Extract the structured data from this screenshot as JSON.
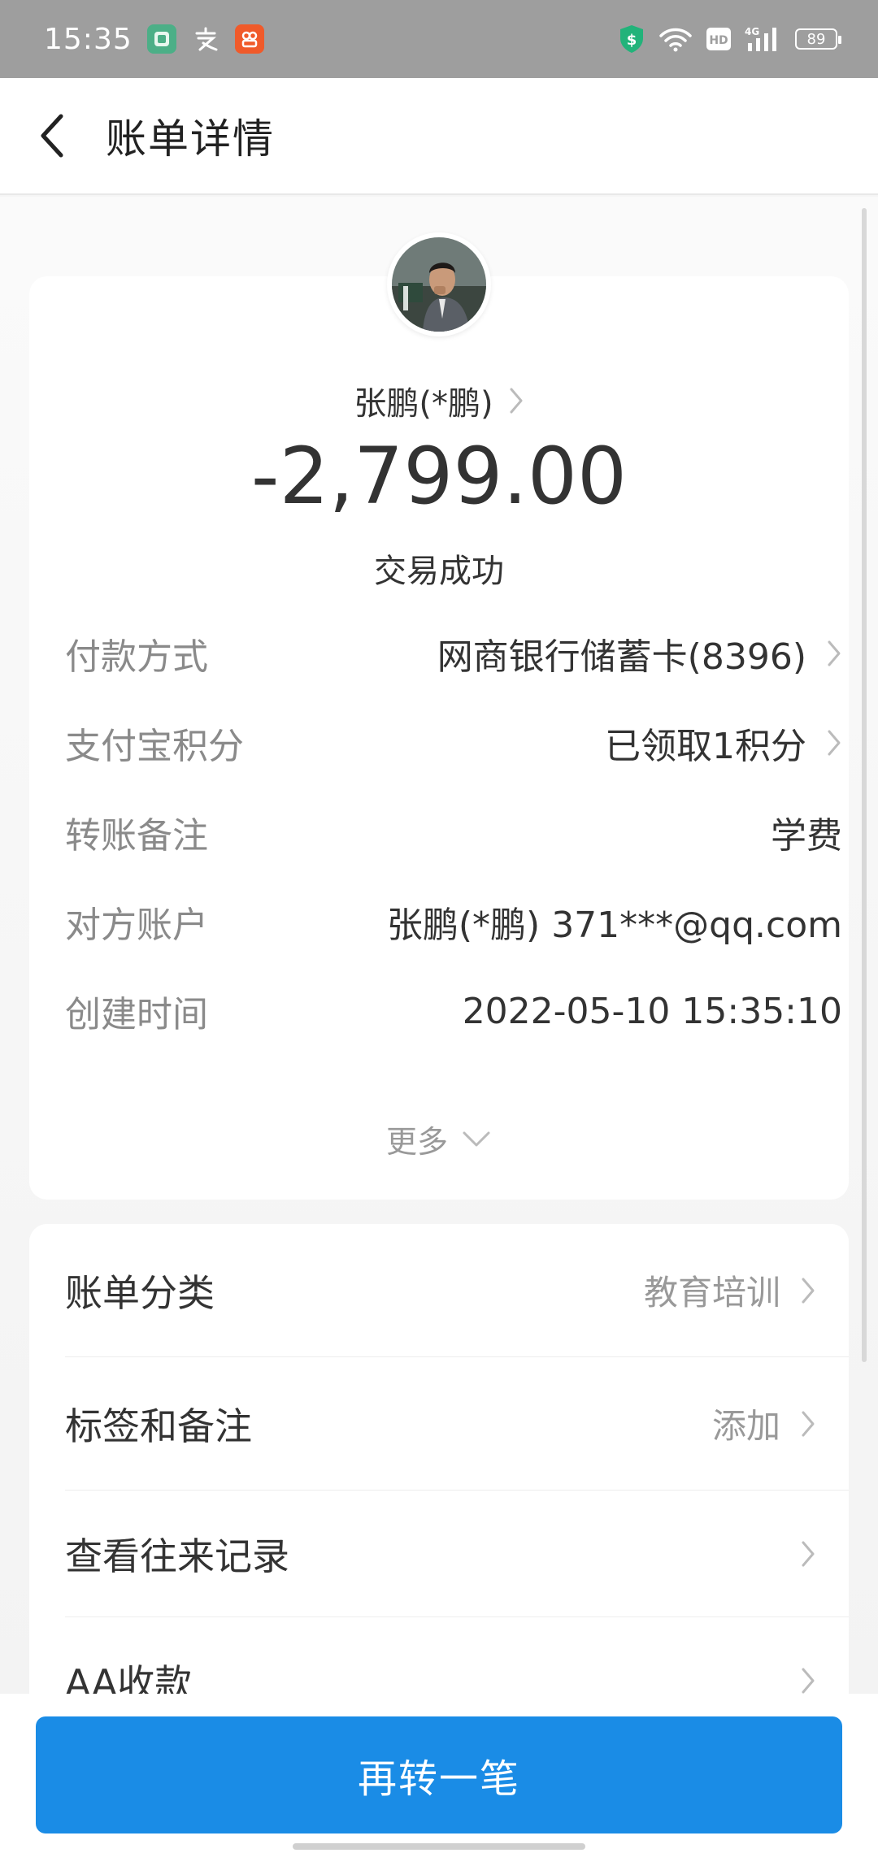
{
  "status_bar": {
    "time": "15:35",
    "battery": "89",
    "app_icons": [
      "app-green-icon",
      "alipay-text-icon",
      "app-orange-icon"
    ],
    "system_icons": [
      "shield-dollar-icon",
      "wifi-icon",
      "hd-icon",
      "4g-signal-icon",
      "battery-icon"
    ]
  },
  "header": {
    "title": "账单详情"
  },
  "payee": {
    "name": "张鹏(*鹏)",
    "amount": "-2,799.00",
    "status": "交易成功"
  },
  "details": [
    {
      "label": "付款方式",
      "value": "网商银行储蓄卡(8396)",
      "chevron": true
    },
    {
      "label": "支付宝积分",
      "value": "已领取1积分",
      "chevron": true
    },
    {
      "label": "转账备注",
      "value": "学费",
      "chevron": false
    },
    {
      "label": "对方账户",
      "value": "张鹏(*鹏) 371***@qq.com",
      "chevron": false
    },
    {
      "label": "创建时间",
      "value": "2022-05-10 15:35:10",
      "chevron": false
    }
  ],
  "more": {
    "label": "更多"
  },
  "actions": [
    {
      "label": "账单分类",
      "value": "教育培训"
    },
    {
      "label": "标签和备注",
      "value": "添加"
    },
    {
      "label": "查看往来记录",
      "value": ""
    },
    {
      "label": "AA收款",
      "value": ""
    }
  ],
  "bottom": {
    "button_label": "再转一笔"
  },
  "colors": {
    "primary": "#1a8ce6",
    "status_bar": "#9e9e9e",
    "label_gray": "#8a8a8a",
    "text_dark": "#333333"
  }
}
